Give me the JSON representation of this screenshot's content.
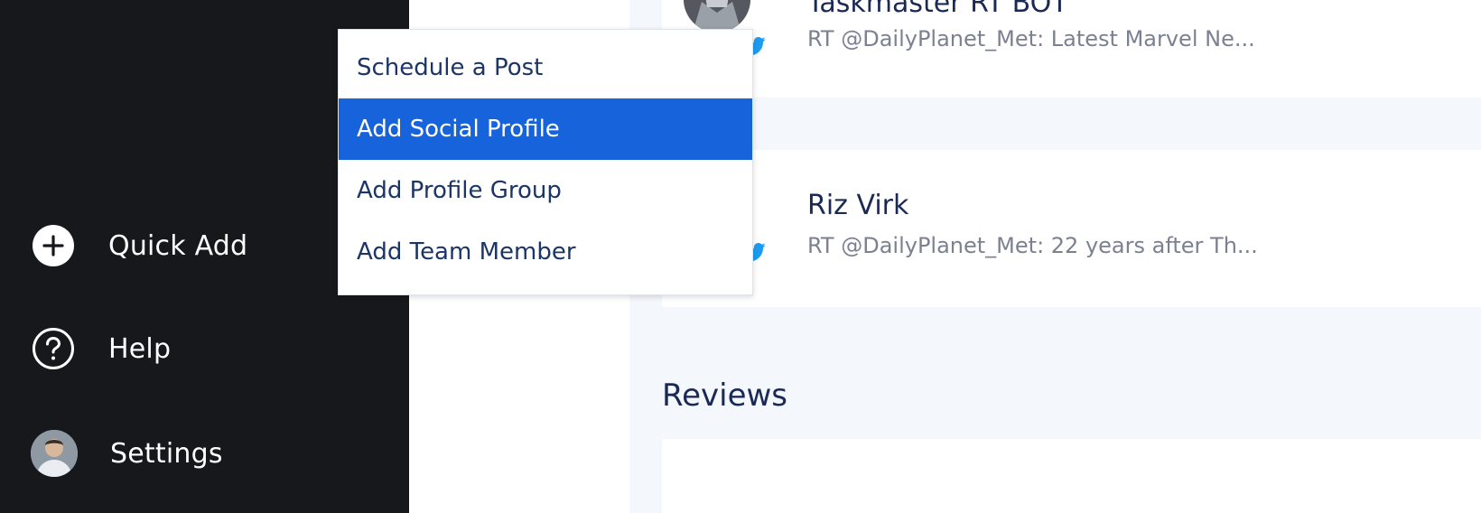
{
  "sidebar": {
    "items": [
      {
        "label": "Quick Add",
        "icon": "plus-circle-icon"
      },
      {
        "label": "Help",
        "icon": "question-circle-icon"
      },
      {
        "label": "Settings",
        "icon": "avatar"
      }
    ]
  },
  "menu": {
    "items": [
      {
        "label": "Schedule a Post",
        "active": false
      },
      {
        "label": "Add Social Profile",
        "active": true
      },
      {
        "label": "Add Profile Group",
        "active": false
      },
      {
        "label": "Add Team Member",
        "active": false
      }
    ]
  },
  "feed": {
    "posts": [
      {
        "name": "Taskmaster RT BOT",
        "text": "RT @DailyPlanet_Met: Latest Marvel Ne...",
        "network_icon": "twitter-icon"
      },
      {
        "name": "Riz Virk",
        "text": "RT @DailyPlanet_Met: 22 years after Th...",
        "network_icon": "twitter-icon"
      }
    ],
    "section_title": "Reviews"
  },
  "colors": {
    "sidebar_bg": "#17181b",
    "menu_active_bg": "#1763dc",
    "text_primary": "#1b2a55",
    "main_bg": "#f4f7fc"
  }
}
